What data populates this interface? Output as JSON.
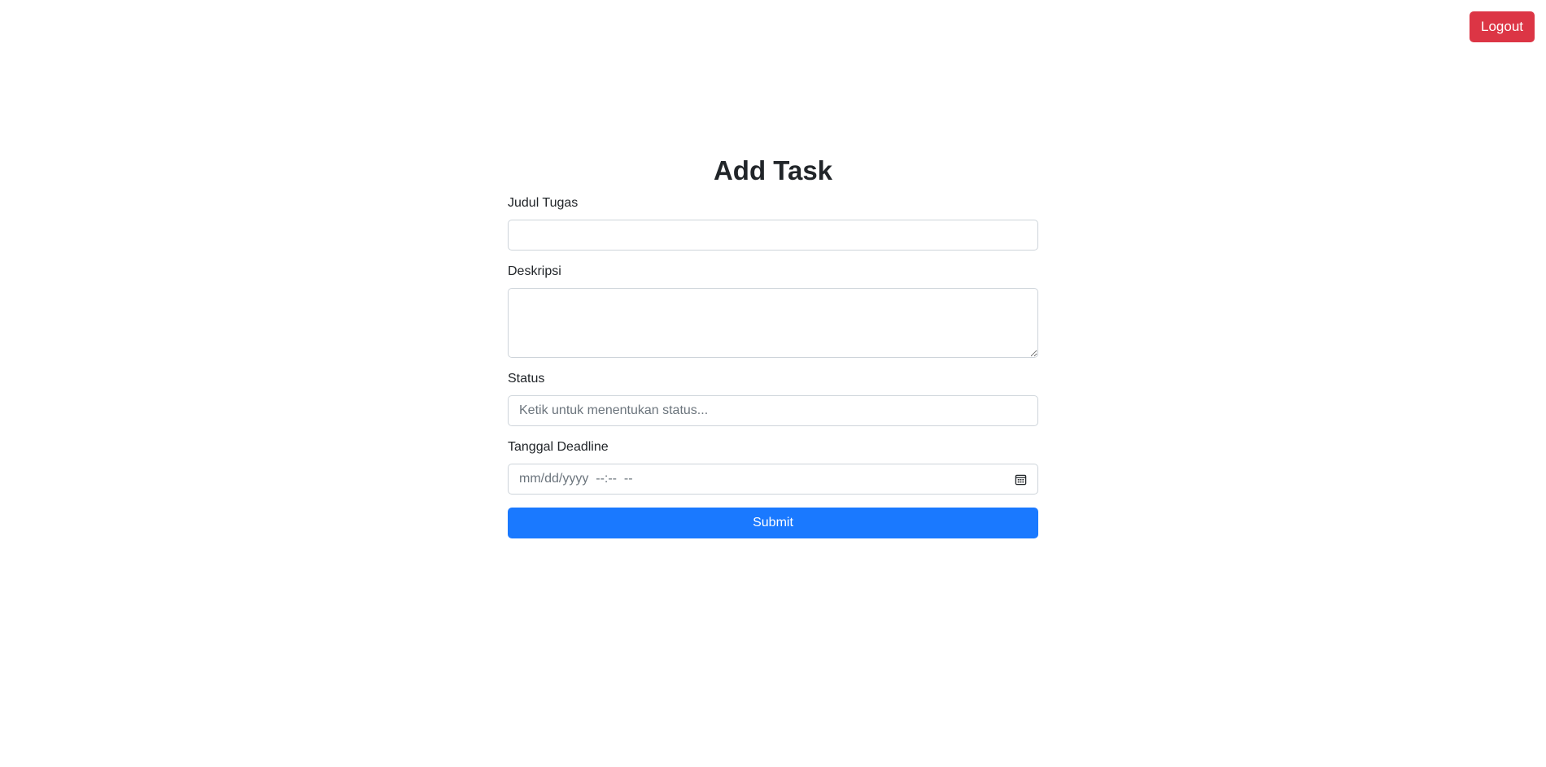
{
  "header": {
    "logout_label": "Logout"
  },
  "form": {
    "title": "Add Task",
    "fields": {
      "judul": {
        "label": "Judul Tugas",
        "value": "",
        "placeholder": ""
      },
      "deskripsi": {
        "label": "Deskripsi",
        "value": "",
        "placeholder": ""
      },
      "status": {
        "label": "Status",
        "value": "",
        "placeholder": "Ketik untuk menentukan status..."
      },
      "deadline": {
        "label": "Tanggal Deadline",
        "placeholder": "mm/dd/yyyy  --:--  --",
        "icon": "calendar-icon"
      }
    },
    "submit_label": "Submit"
  },
  "colors": {
    "logout": "#dc3545",
    "submit": "#1a79ff",
    "border": "#ced4da",
    "text": "#212529"
  }
}
